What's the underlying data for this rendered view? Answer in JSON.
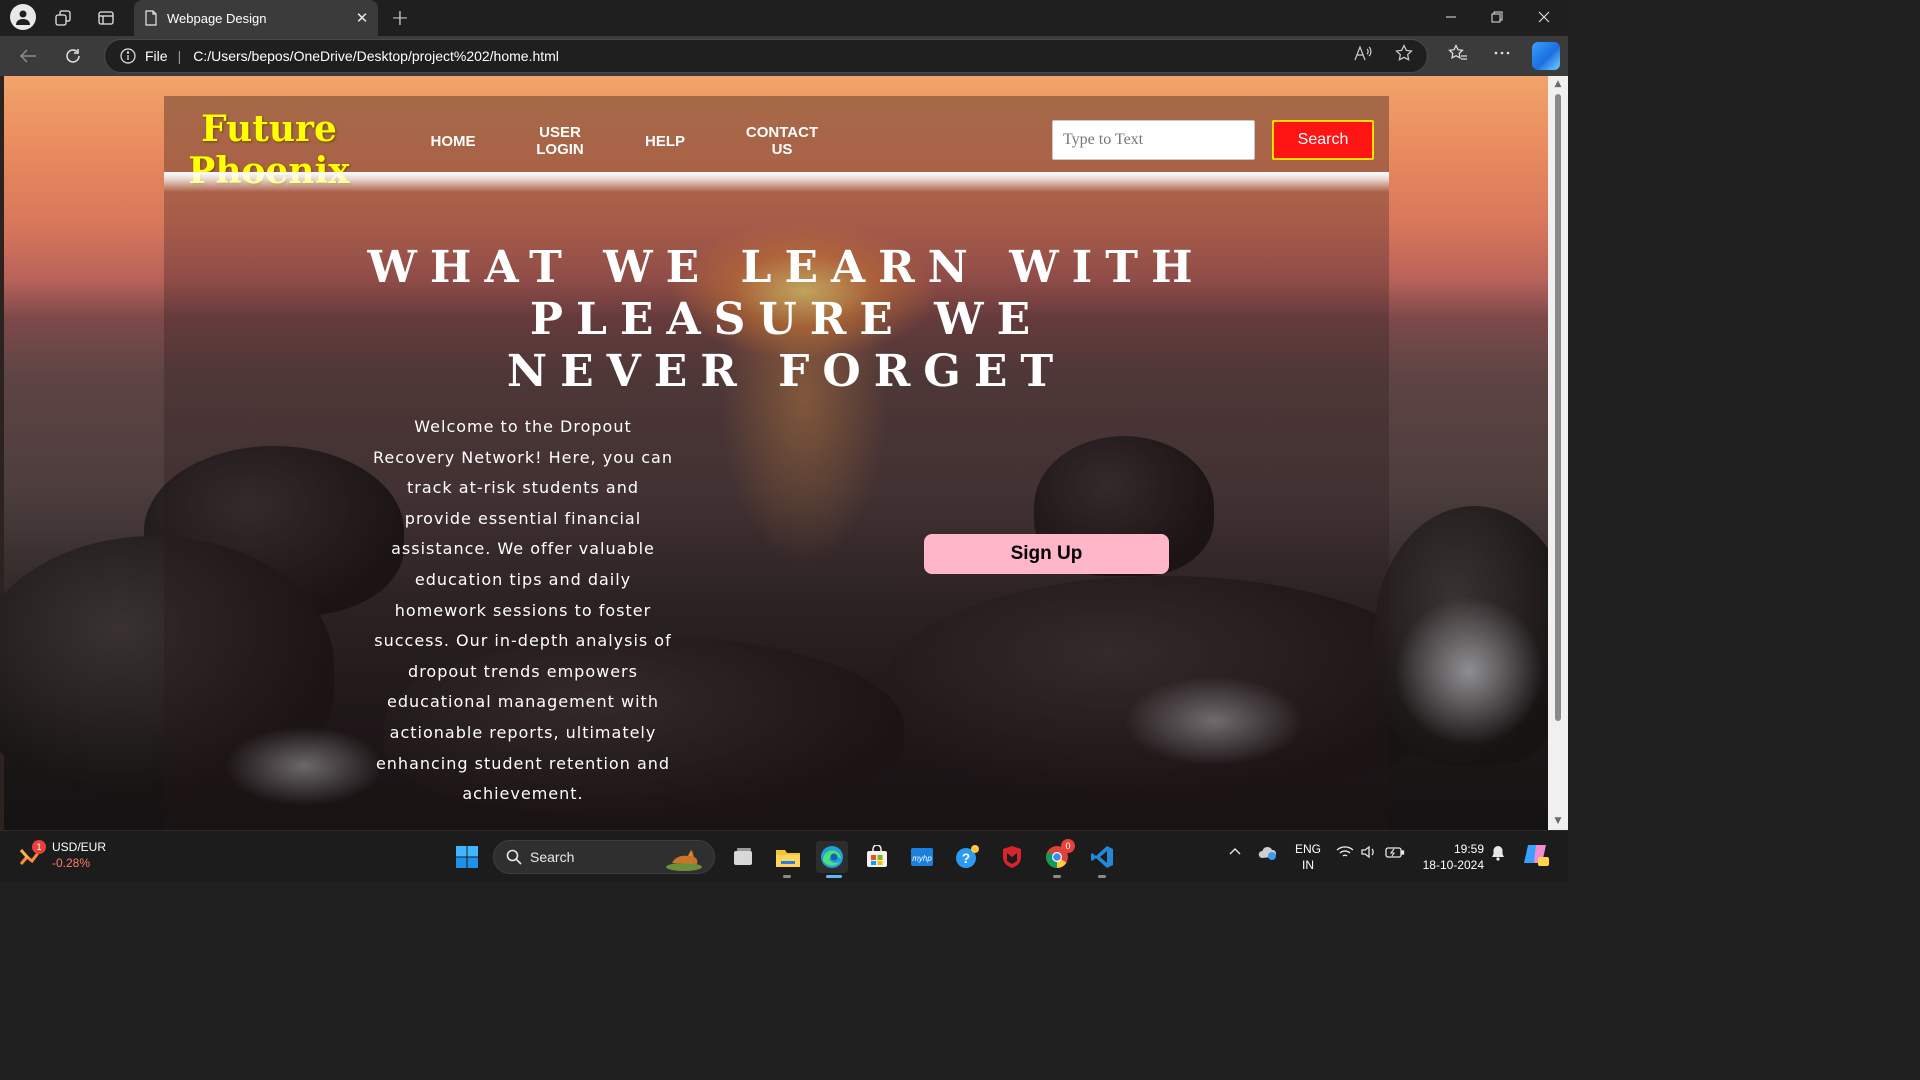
{
  "browser": {
    "tab_title": "Webpage Design",
    "address_scheme": "File",
    "address_url": "C:/Users/bepos/OneDrive/Desktop/project%202/home.html"
  },
  "site": {
    "logo_line1": "Future",
    "logo_line2": "Phoenix",
    "nav": {
      "home": "HOME",
      "user_login_line1": "USER",
      "user_login_line2": "LOGIN",
      "help": "HELP",
      "contact_line1": "CONTACT",
      "contact_line2": "US"
    },
    "search_placeholder": "Type to Text",
    "search_button": "Search",
    "headline_line1": "WHAT WE LEARN WITH PLEASURE WE",
    "headline_line2": "NEVER FORGET",
    "intro": "Welcome to the Dropout Recovery Network! Here, you can track at-risk students and provide essential financial assistance. We offer valuable education tips and daily homework sessions to foster success. Our in-depth analysis of dropout trends empowers educational management with actionable reports, ultimately enhancing student retention and achievement.",
    "signup_button": "Sign Up",
    "colors": {
      "logo": "#ffff00",
      "search_button_bg": "#ff1414",
      "search_button_border": "#ffde00",
      "signup_bg": "#ffb6c8"
    }
  },
  "taskbar": {
    "widget_badge": "1",
    "widget_title": "USD/EUR",
    "widget_value": "-0.28%",
    "search_label": "Search",
    "chrome_badge": "0",
    "lang_line1": "ENG",
    "lang_line2": "IN",
    "time": "19:59",
    "date": "18-10-2024"
  }
}
